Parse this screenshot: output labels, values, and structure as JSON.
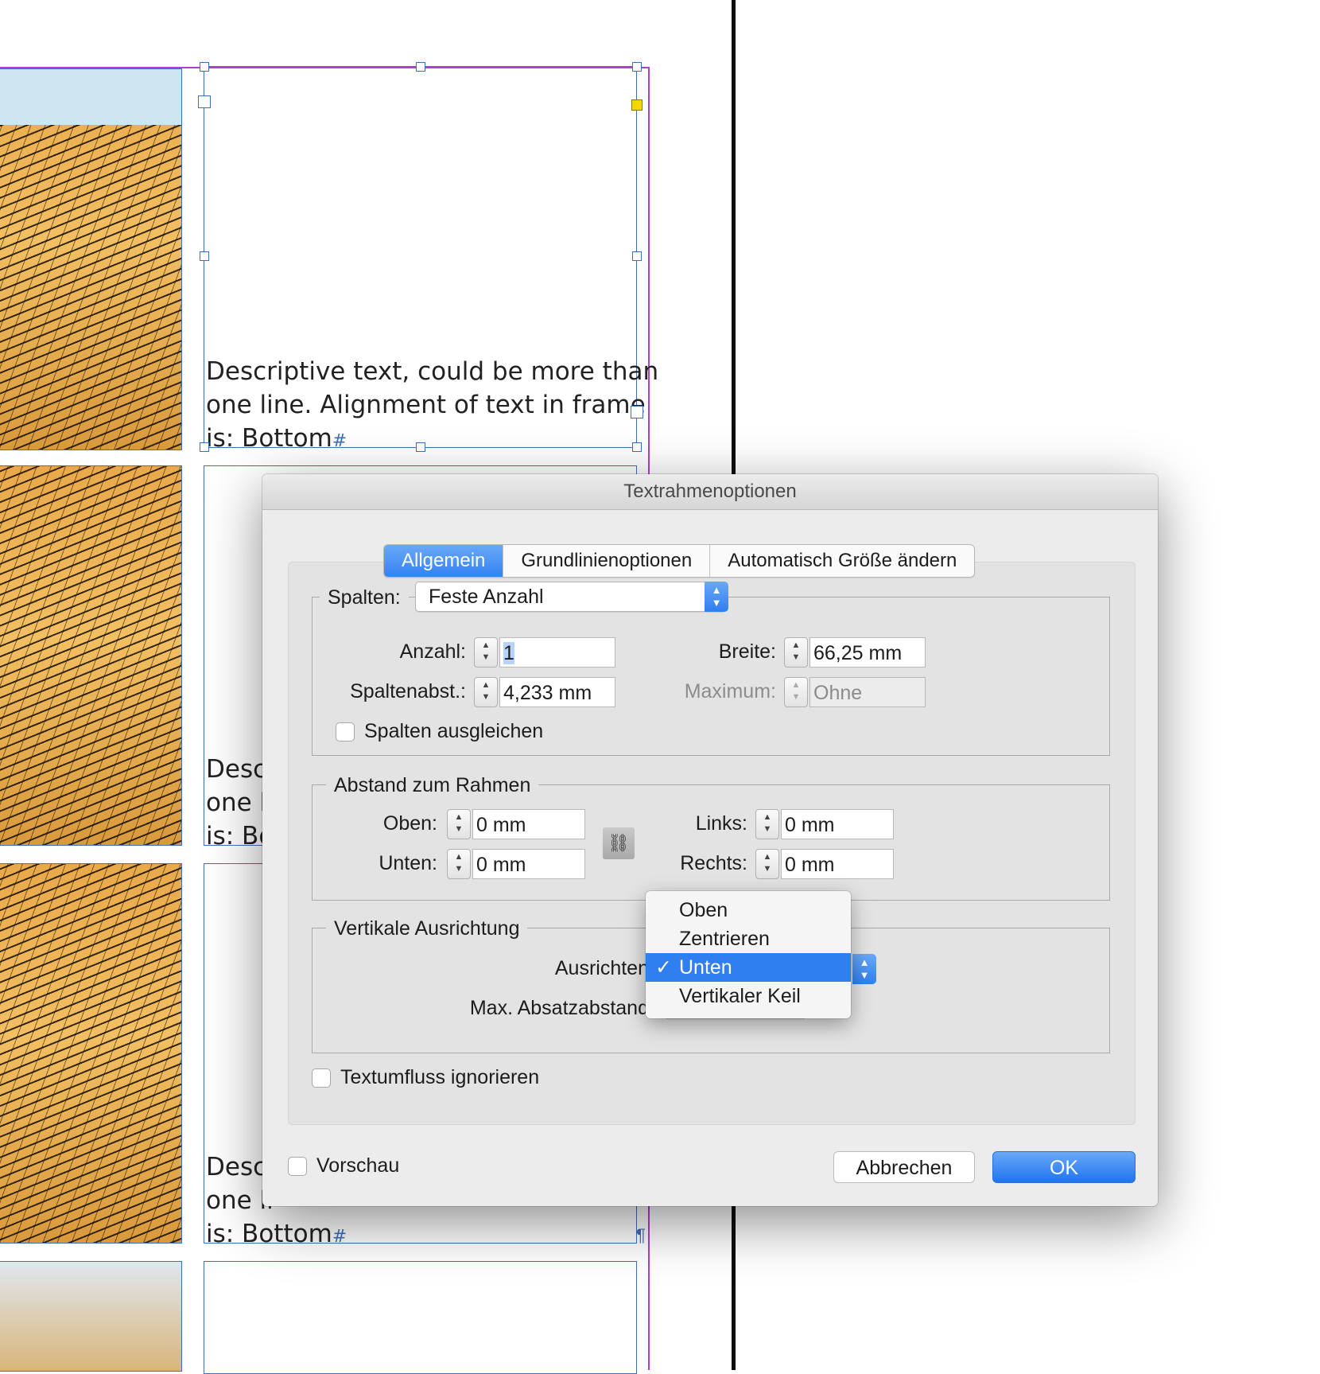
{
  "document": {
    "frame_text_line1": "Descriptive text, could be more than",
    "frame_text_line2": "one line. Alignment of text in frame",
    "frame_text_line3": "is: Bottom",
    "partial_line1": "Desc",
    "partial_line2": "one li",
    "partial_line3": "is: Bo",
    "partial_line2_b": "one li",
    "partial_line3_b": "is: Bottom",
    "end_marker": "#",
    "pilcrow": "¶"
  },
  "dialog": {
    "title": "Textrahmenoptionen",
    "tabs": [
      {
        "label": "Allgemein",
        "active": true
      },
      {
        "label": "Grundlinienoptionen",
        "active": false
      },
      {
        "label": "Automatisch Größe ändern",
        "active": false
      }
    ],
    "columns": {
      "label": "Spalten:",
      "type_value": "Feste Anzahl",
      "count_label": "Anzahl:",
      "count_value": "1",
      "gutter_label": "Spaltenabst.:",
      "gutter_value": "4,233 mm",
      "width_label": "Breite:",
      "width_value": "66,25 mm",
      "max_label": "Maximum:",
      "max_value": "Ohne",
      "balance_label": "Spalten ausgleichen",
      "balance_checked": false
    },
    "inset": {
      "legend": "Abstand zum Rahmen",
      "top_label": "Oben:",
      "top_value": "0 mm",
      "bottom_label": "Unten:",
      "bottom_value": "0 mm",
      "left_label": "Links:",
      "left_value": "0 mm",
      "right_label": "Rechts:",
      "right_value": "0 mm"
    },
    "vertical": {
      "legend": "Vertikale Ausrichtung",
      "align_label": "Ausrichten",
      "max_spacing_label": "Max. Absatzabstand",
      "options": [
        "Oben",
        "Zentrieren",
        "Unten",
        "Vertikaler Keil"
      ],
      "selected": "Unten",
      "check_glyph": "✓"
    },
    "ignore_wrap_label": "Textumfluss ignorieren",
    "ignore_wrap_checked": false,
    "preview_label": "Vorschau",
    "preview_checked": false,
    "cancel_label": "Abbrechen",
    "ok_label": "OK"
  },
  "colors": {
    "accent": "#2f7ff0",
    "frame_blue": "#3f6fb8",
    "margin_purple": "#b13ed3"
  }
}
